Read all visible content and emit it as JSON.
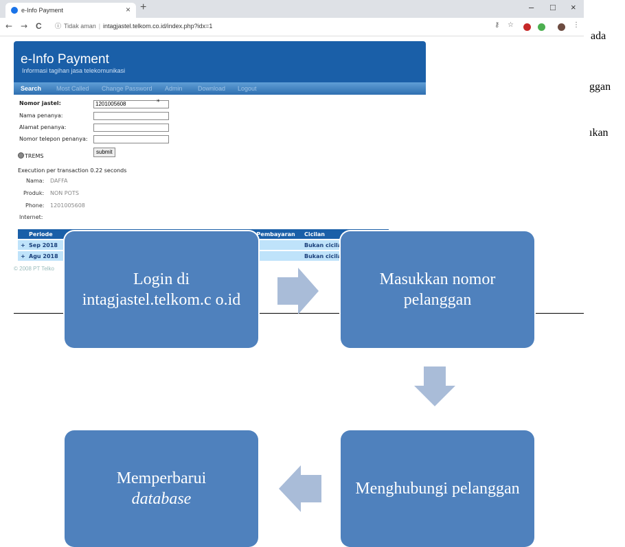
{
  "browser": {
    "tab_title": "e-Info Payment",
    "tab_close": "×",
    "new_tab": "+",
    "security_label": "Tidak aman",
    "url": "intagjastel.telkom.co.id/index.php?idx=1",
    "win_min": "–",
    "win_max": "□",
    "win_close": "×",
    "back": "←",
    "forward": "→",
    "reload": "C",
    "info_icon_glyph": "ⓘ"
  },
  "site": {
    "title": "e-Info Payment",
    "subtitle": "Informasi tagihan jasa telekomunikasi",
    "nav": [
      "Search",
      "Most Called",
      "Change Password",
      "Admin",
      "Download",
      "Logout"
    ],
    "form": {
      "nomor_label": "Nomor jastel:",
      "nomor_value": "1201005608",
      "nama_label": "Nama penanya:",
      "alamat_label": "Alamat penanya:",
      "telepon_label": "Nomor telepon penanya:",
      "required_mark": "*",
      "radio_label": "TREMS",
      "submit_label": "submit"
    },
    "execution": "Execution per transaction 0.22 seconds",
    "info": {
      "nama_key": "Nama:",
      "nama_val": "DAFFA",
      "produk_key": "Produk:",
      "produk_val": "NON POTS",
      "phone_key": "Phone:",
      "phone_val": "1201005608",
      "internet_key": "Internet:"
    },
    "table": {
      "headers": [
        "Periode",
        "i Pembayaran",
        "Cicilan"
      ],
      "rows": [
        {
          "expand": "+",
          "periode": "Sep 2018",
          "cicilan": "Bukan cicila"
        },
        {
          "expand": "+",
          "periode": "Agu 2018",
          "cicilan": "Bukan cicila"
        }
      ]
    },
    "copyright": "© 2008 PT Telko"
  },
  "document_fragments": [
    "ada",
    "ggan",
    "ıkan"
  ],
  "flow": {
    "step1": "Login di intagjastel.telkom.c o.id",
    "step2": "Masukkan nomor pelanggan",
    "step3": "Menghubungi pelanggan",
    "step4_line1": "Memperbarui",
    "step4_line2": "database",
    "box_color": "#4f81bd",
    "arrow_color": "#a9bcd8"
  }
}
